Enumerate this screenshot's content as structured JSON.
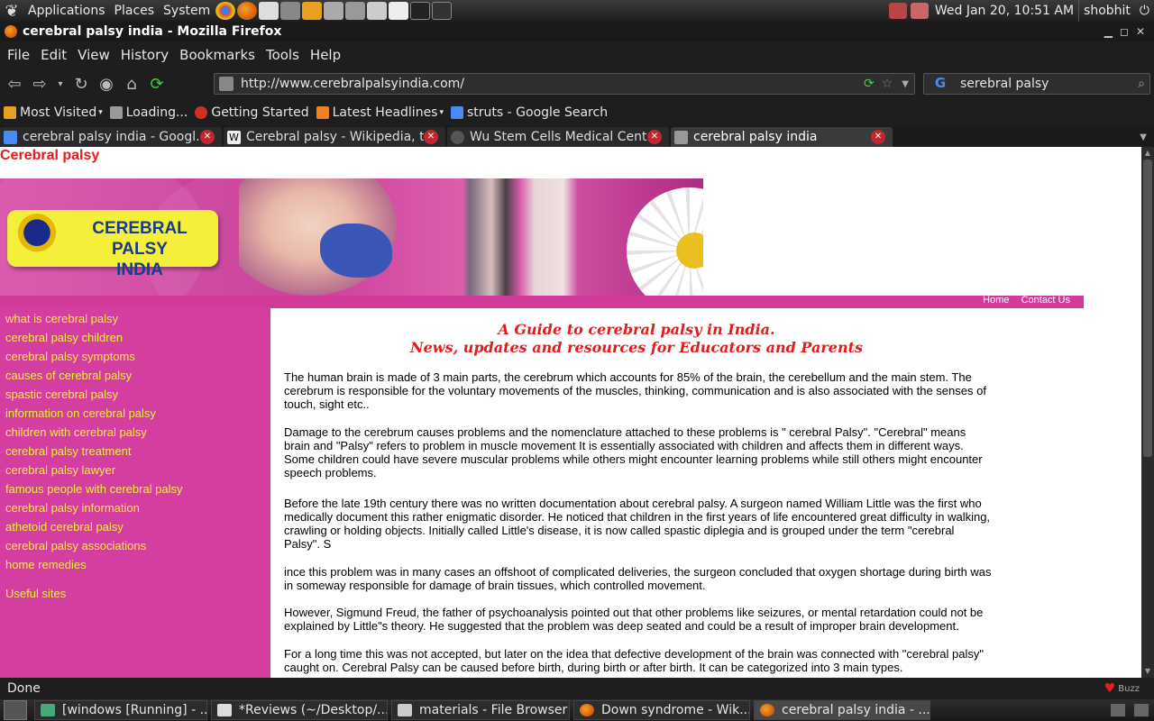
{
  "panel": {
    "menus": [
      "Applications",
      "Places",
      "System"
    ],
    "clock": "Wed Jan 20, 10:51 AM",
    "user": "shobhit"
  },
  "window": {
    "title": "cerebral palsy india - Mozilla Firefox"
  },
  "menubar": [
    "File",
    "Edit",
    "View",
    "History",
    "Bookmarks",
    "Tools",
    "Help"
  ],
  "navbar": {
    "url": "http://www.cerebralpalsyindia.com/",
    "search_value": "serebral palsy",
    "search_engine_icon": "G"
  },
  "bookmarks": [
    {
      "label": "Most Visited",
      "dropdown": true
    },
    {
      "label": "Loading...",
      "dropdown": false
    },
    {
      "label": "Getting Started",
      "dropdown": false
    },
    {
      "label": "Latest Headlines",
      "dropdown": true
    },
    {
      "label": "struts - Google Search",
      "dropdown": false
    }
  ],
  "tabs": [
    {
      "label": "cerebral palsy india - Googl...",
      "active": false
    },
    {
      "label": "Cerebral palsy - Wikipedia, t...",
      "active": false
    },
    {
      "label": "Wu Stem Cells Medical Cent...",
      "active": false
    },
    {
      "label": "cerebral palsy india",
      "active": true
    }
  ],
  "page": {
    "title": "Cerebral palsy",
    "logo_line1": "CEREBRAL PALSY",
    "logo_line2": "INDIA",
    "top_links": [
      "Home",
      "Contact Us"
    ],
    "sidebar": [
      "what is cerebral palsy",
      "cerebral palsy children",
      "cerebral palsy symptoms",
      "causes of cerebral palsy",
      "spastic cerebral palsy",
      "information on cerebral palsy",
      "children with cerebral palsy",
      "cerebral palsy treatment",
      "cerebral palsy lawyer",
      "famous people with cerebral palsy",
      "cerebral palsy information",
      "athetoid cerebral palsy",
      "cerebral palsy associations",
      "home remedies"
    ],
    "useful_sites": "Useful sites",
    "heading_line1": "A Guide to cerebral palsy in India.",
    "heading_line2": "News, updates and resources for Educators and Parents",
    "paragraphs": [
      "The human brain is made of 3 main parts, the cerebrum which accounts for 85% of the brain, the cerebellum and the main stem. The cerebrum is responsible for the voluntary movements of the muscles, thinking, communication and is also associated with the senses of touch, sight etc..",
      "Damage to the cerebrum causes problems and the nomenclature attached to these problems is \" cerebral Palsy\". \"Cerebral\" means brain and \"Palsy\" refers to problem in muscle movement It is essentially associated with children and affects them in different ways. Some children could have severe muscular problems while others might encounter learning problems while still others might encounter speech problems.",
      "Before the late 19th century there was no written documentation about cerebral palsy. A surgeon named William Little was the first who medically document this rather enigmatic disorder. He noticed that children in the first years of life encountered great difficulty in walking, crawling or holding objects. Initially called Little's disease, it is now called spastic diplegia and is grouped under the term \"cerebral Palsy\". S",
      "ince this problem was in many cases an offshoot of complicated deliveries, the surgeon concluded that oxygen shortage during birth was in someway responsible for damage of brain tissues, which controlled movement.",
      "However, Sigmund Freud, the father of psychoanalysis pointed out that other problems like seizures, or mental retardation could not be explained by Little\"s theory. He suggested that the problem was deep seated and could be a result of improper brain development.",
      "For a long time this was not accepted, but later on the idea that defective development of the brain was connected with \"cerebral palsy\" caught on. Cerebral Palsy can be caused before birth, during birth or after birth. It can be categorized into 3 main types."
    ]
  },
  "status": {
    "text": "Done",
    "buzz": "Buzz"
  },
  "taskbar": [
    {
      "label": "[windows [Running] - ...",
      "active": false
    },
    {
      "label": "*Reviews (~/Desktop/...",
      "active": false
    },
    {
      "label": "materials - File Browser",
      "active": false
    },
    {
      "label": "Down syndrome - Wik...",
      "active": false
    },
    {
      "label": "cerebral palsy india - ...",
      "active": true
    }
  ],
  "colors": {
    "page_title_red": "#e21c1c",
    "site_magenta": "#d43ea0",
    "sidebar_link_yellow": "#f5ee3a",
    "logo_blue": "#173b8f"
  }
}
